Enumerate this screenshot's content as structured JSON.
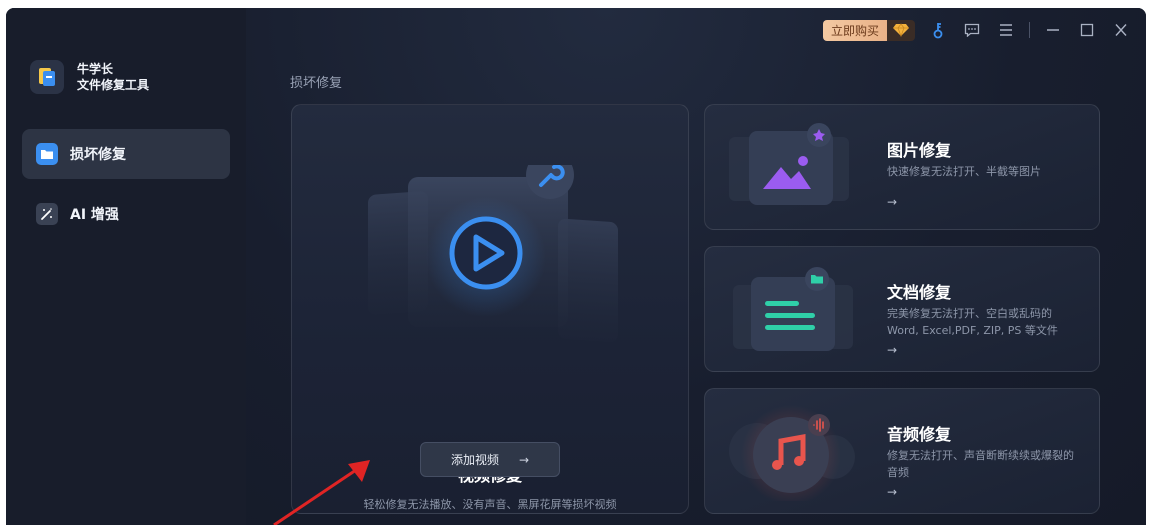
{
  "app": {
    "name_line1": "牛学长",
    "name_line2": "文件修复工具"
  },
  "sidebar": {
    "items": [
      {
        "label": "损坏修复",
        "active": true,
        "icon": "folder-icon"
      },
      {
        "label": "AI 增强",
        "active": false,
        "icon": "magic-wand-icon"
      }
    ]
  },
  "titlebar": {
    "buy_label": "立即购买",
    "icons": [
      "diamond-icon",
      "key-icon",
      "feedback-icon",
      "menu-icon",
      "minimize-icon",
      "maximize-icon",
      "close-icon"
    ]
  },
  "main": {
    "section_title": "损坏修复",
    "video": {
      "title": "视频修复",
      "desc": "轻松修复无法播放、没有声音、黑屏花屏等损坏视频",
      "button_label": "添加视频",
      "arrow": "→"
    },
    "cards": [
      {
        "title": "图片修复",
        "desc": "快速修复无法打开、半截等图片",
        "arrow": "→"
      },
      {
        "title": "文档修复",
        "desc": "完美修复无法打开、空白或乱码的 Word, Excel,PDF, ZIP, PS 等文件",
        "arrow": "→"
      },
      {
        "title": "音频修复",
        "desc": "修复无法打开、声音断断续续或爆裂的音频",
        "arrow": "→"
      }
    ]
  },
  "colors": {
    "accent_blue": "#3b8ff0",
    "purple": "#9b5cf0",
    "green": "#2fcfa8",
    "red": "#e8554d",
    "gold": "#e9b187"
  }
}
